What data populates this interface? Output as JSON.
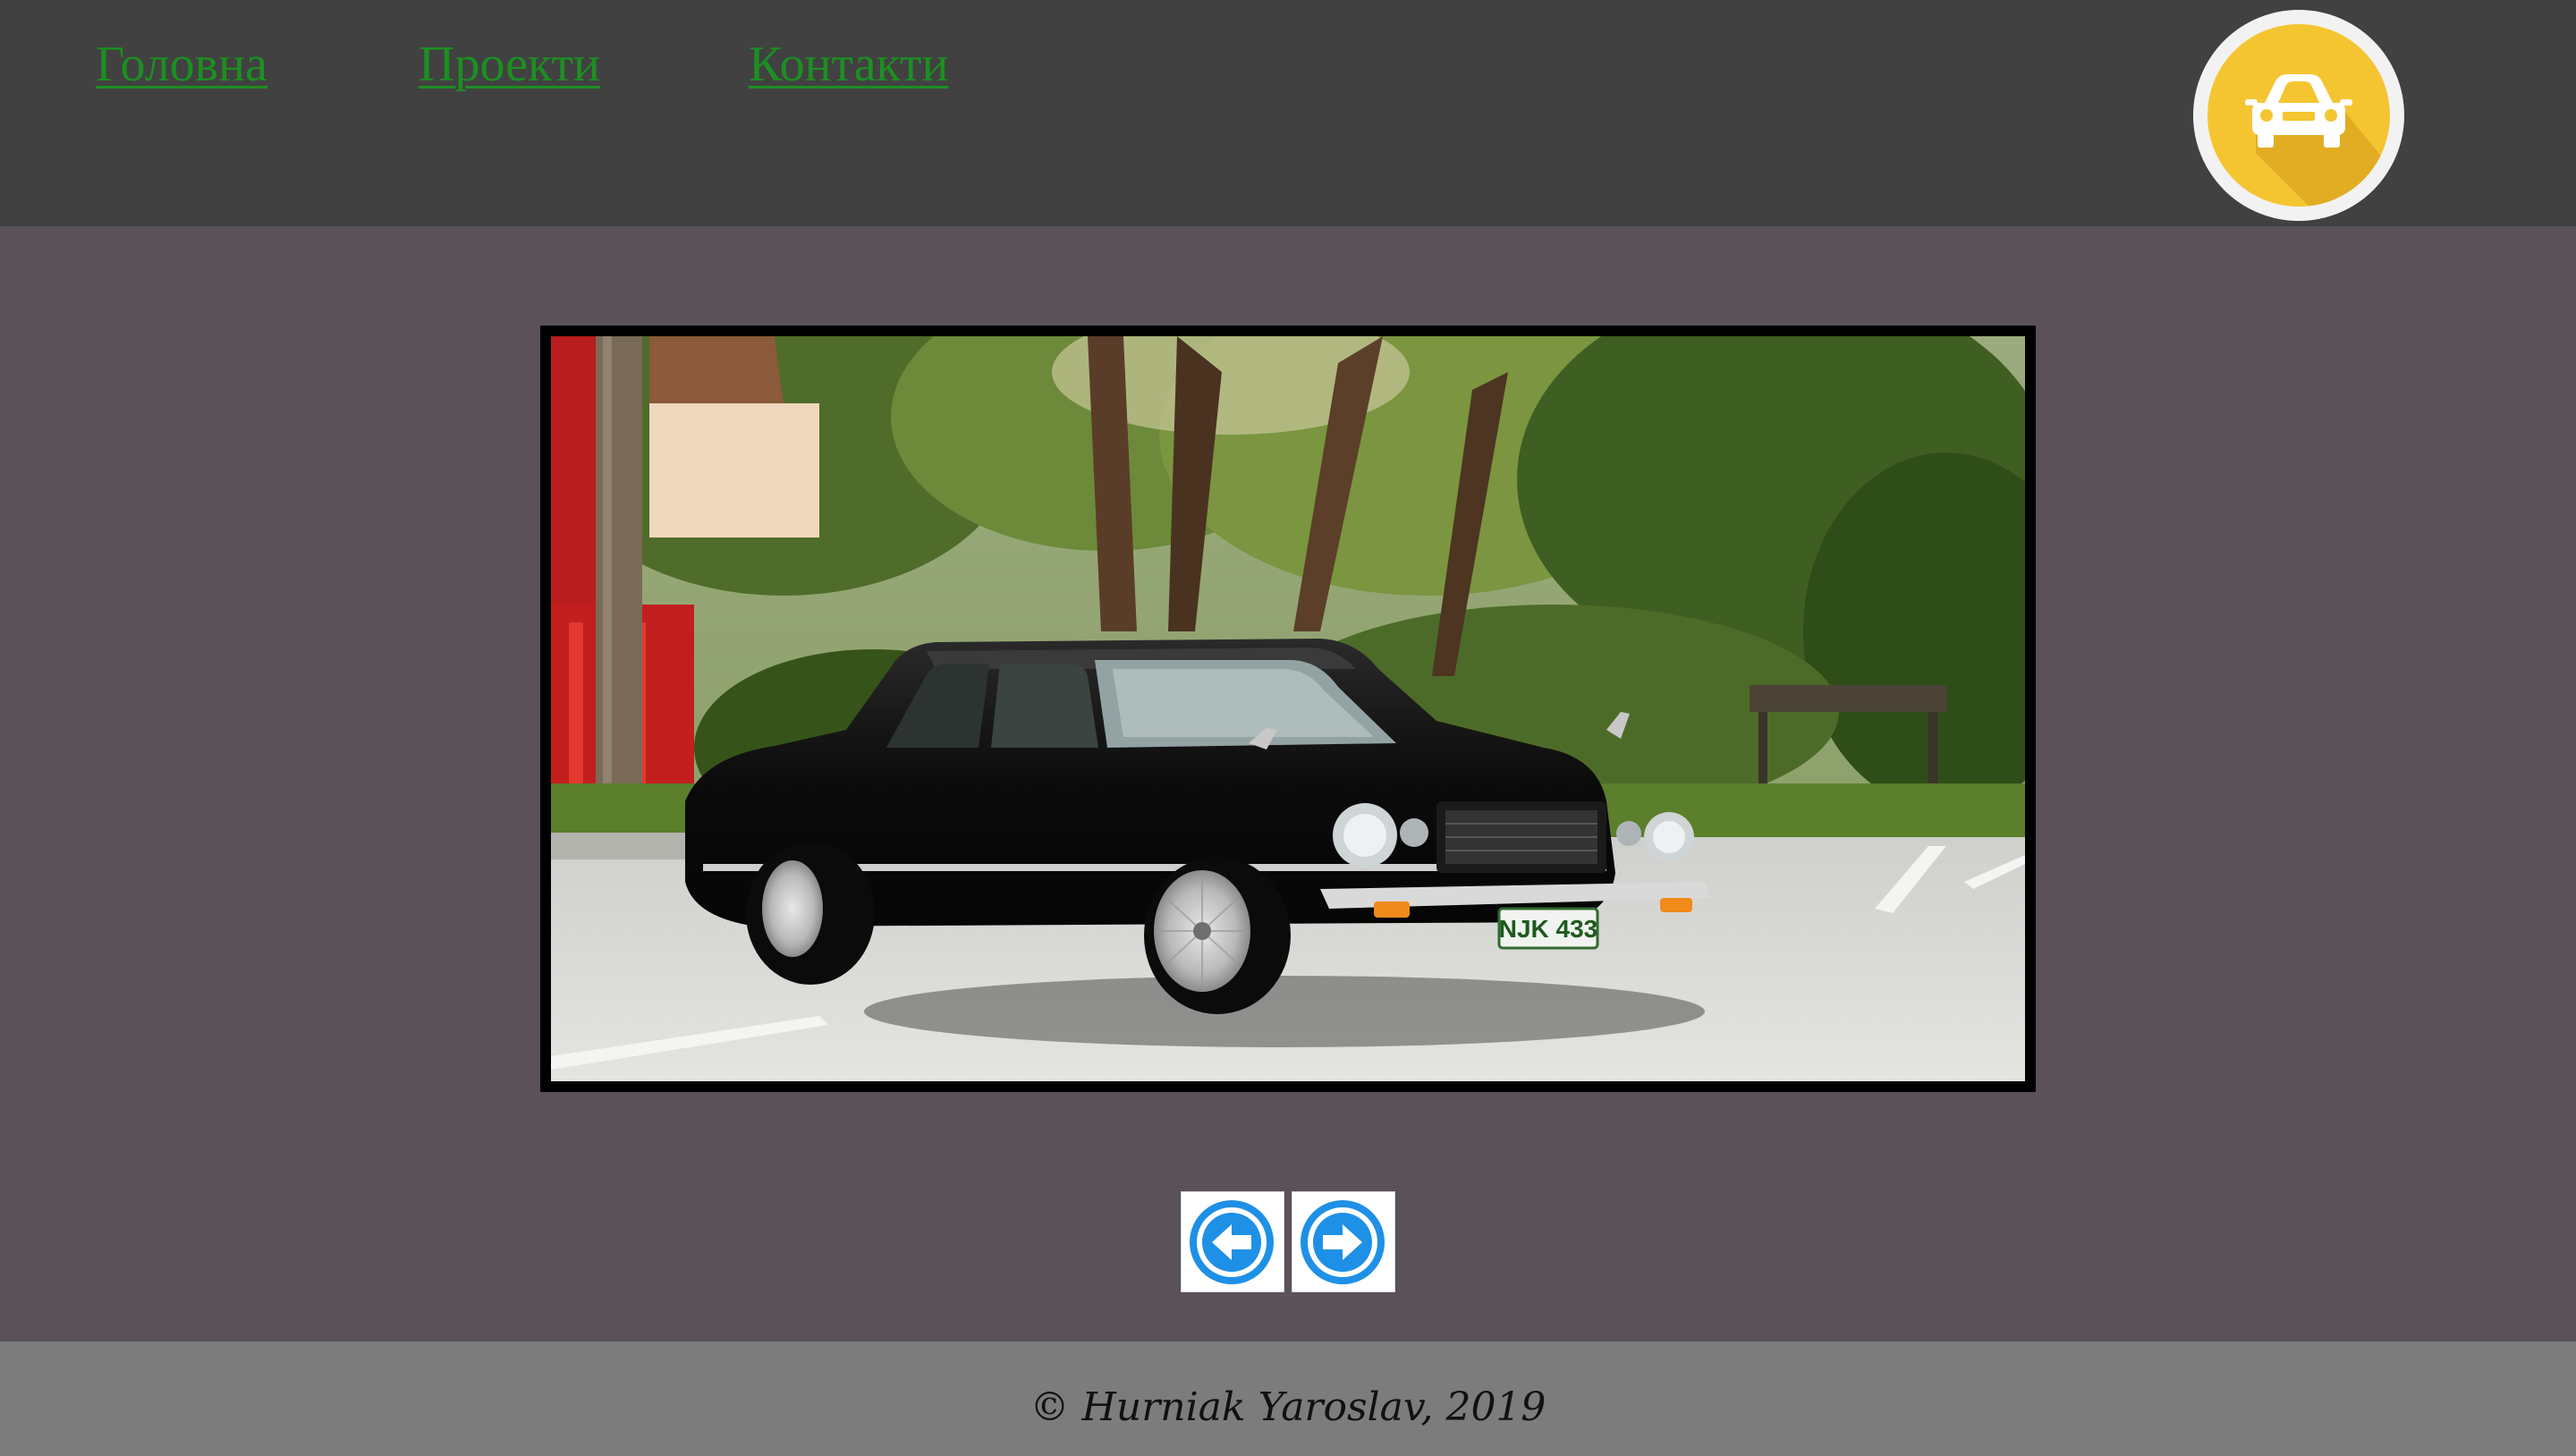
{
  "nav": {
    "home": "Головна",
    "projects": "Проекти",
    "contacts": "Контакти"
  },
  "logo": {
    "icon": "car-icon",
    "badge_color": "#f5c531",
    "ring_color": "#f2f2f2"
  },
  "gallery": {
    "image_alt": "black-vintage-sedan-photo",
    "license_plate": "NJK 433",
    "prev_icon": "arrow-left-circle-icon",
    "next_icon": "arrow-right-circle-icon",
    "button_color": "#1e90e6"
  },
  "footer": {
    "copyright": "© Hurniak Yaroslav, 2019"
  },
  "colors": {
    "header_bg": "#414141",
    "page_bg": "#5a5159",
    "footer_bg": "#7c7c7c",
    "link": "#1c8f22"
  }
}
